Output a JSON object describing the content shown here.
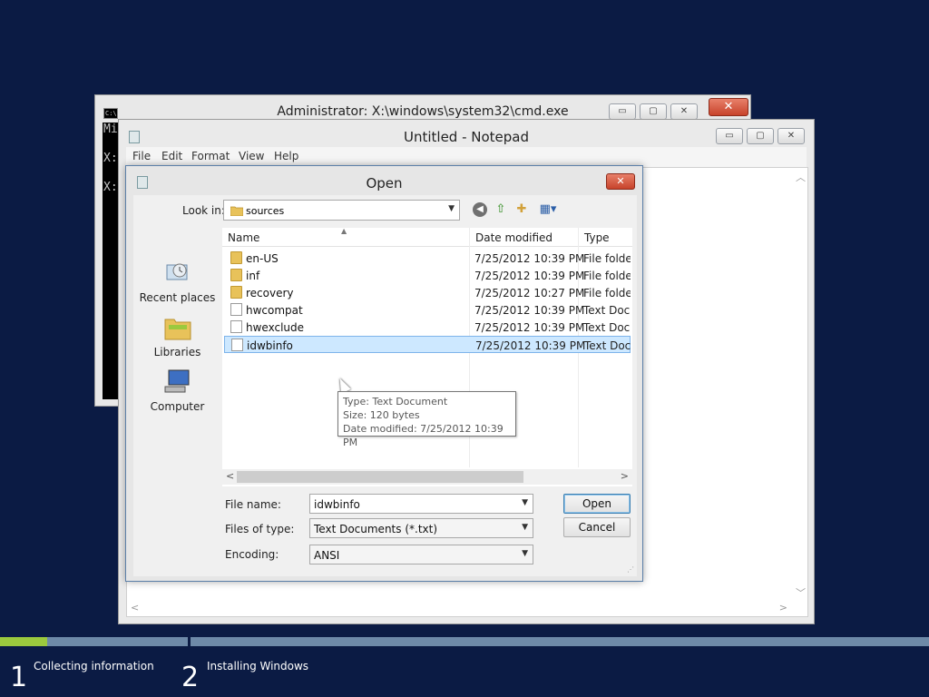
{
  "cmd": {
    "title": "Administrator: X:\\windows\\system32\\cmd.exe",
    "icon_text": "C:\\",
    "console_text": "Mi\n\nX:\n\nX:",
    "close_label": "✕",
    "min_label": "▭",
    "max_label": "▢",
    "x_label": "✕"
  },
  "notepad": {
    "title": "Untitled - Notepad",
    "menu": [
      "File",
      "Edit",
      "Format",
      "View",
      "Help"
    ],
    "min_label": "▭",
    "max_label": "▢",
    "close_label": "✕"
  },
  "dialog": {
    "title": "Open",
    "close_label": "✕",
    "look_in_label": "Look in:",
    "look_in_value": "sources",
    "places": [
      "Recent places",
      "Libraries",
      "Computer"
    ],
    "columns": [
      "Name",
      "Date modified",
      "Type"
    ],
    "files": [
      {
        "name": "en-US",
        "date": "7/25/2012 10:39 PM",
        "type": "File folder",
        "kind": "folder"
      },
      {
        "name": "inf",
        "date": "7/25/2012 10:39 PM",
        "type": "File folder",
        "kind": "folder"
      },
      {
        "name": "recovery",
        "date": "7/25/2012 10:27 PM",
        "type": "File folder",
        "kind": "folder"
      },
      {
        "name": "hwcompat",
        "date": "7/25/2012 10:39 PM",
        "type": "Text Document",
        "kind": "doc"
      },
      {
        "name": "hwexclude",
        "date": "7/25/2012 10:39 PM",
        "type": "Text Document",
        "kind": "doc"
      },
      {
        "name": "idwbinfo",
        "date": "7/25/2012 10:39 PM",
        "type": "Text Document",
        "kind": "doc"
      }
    ],
    "tooltip": {
      "type_line": "Type: Text Document",
      "size_line": "Size: 120 bytes",
      "date_line": "Date modified: 7/25/2012 10:39 PM"
    },
    "file_name_label": "File name:",
    "file_name_value": "idwbinfo",
    "files_of_type_label": "Files of type:",
    "files_of_type_value": "Text Documents (*.txt)",
    "encoding_label": "Encoding:",
    "encoding_value": "ANSI",
    "open_button": "Open",
    "cancel_button": "Cancel"
  },
  "setup": {
    "progress_step1": 0.25,
    "steps": [
      {
        "num": "1",
        "label": "Collecting information"
      },
      {
        "num": "2",
        "label": "Installing Windows"
      }
    ],
    "colors": {
      "fill": "#9bc93e",
      "track": "#6e8aa8",
      "background": "#0b1b44"
    }
  }
}
